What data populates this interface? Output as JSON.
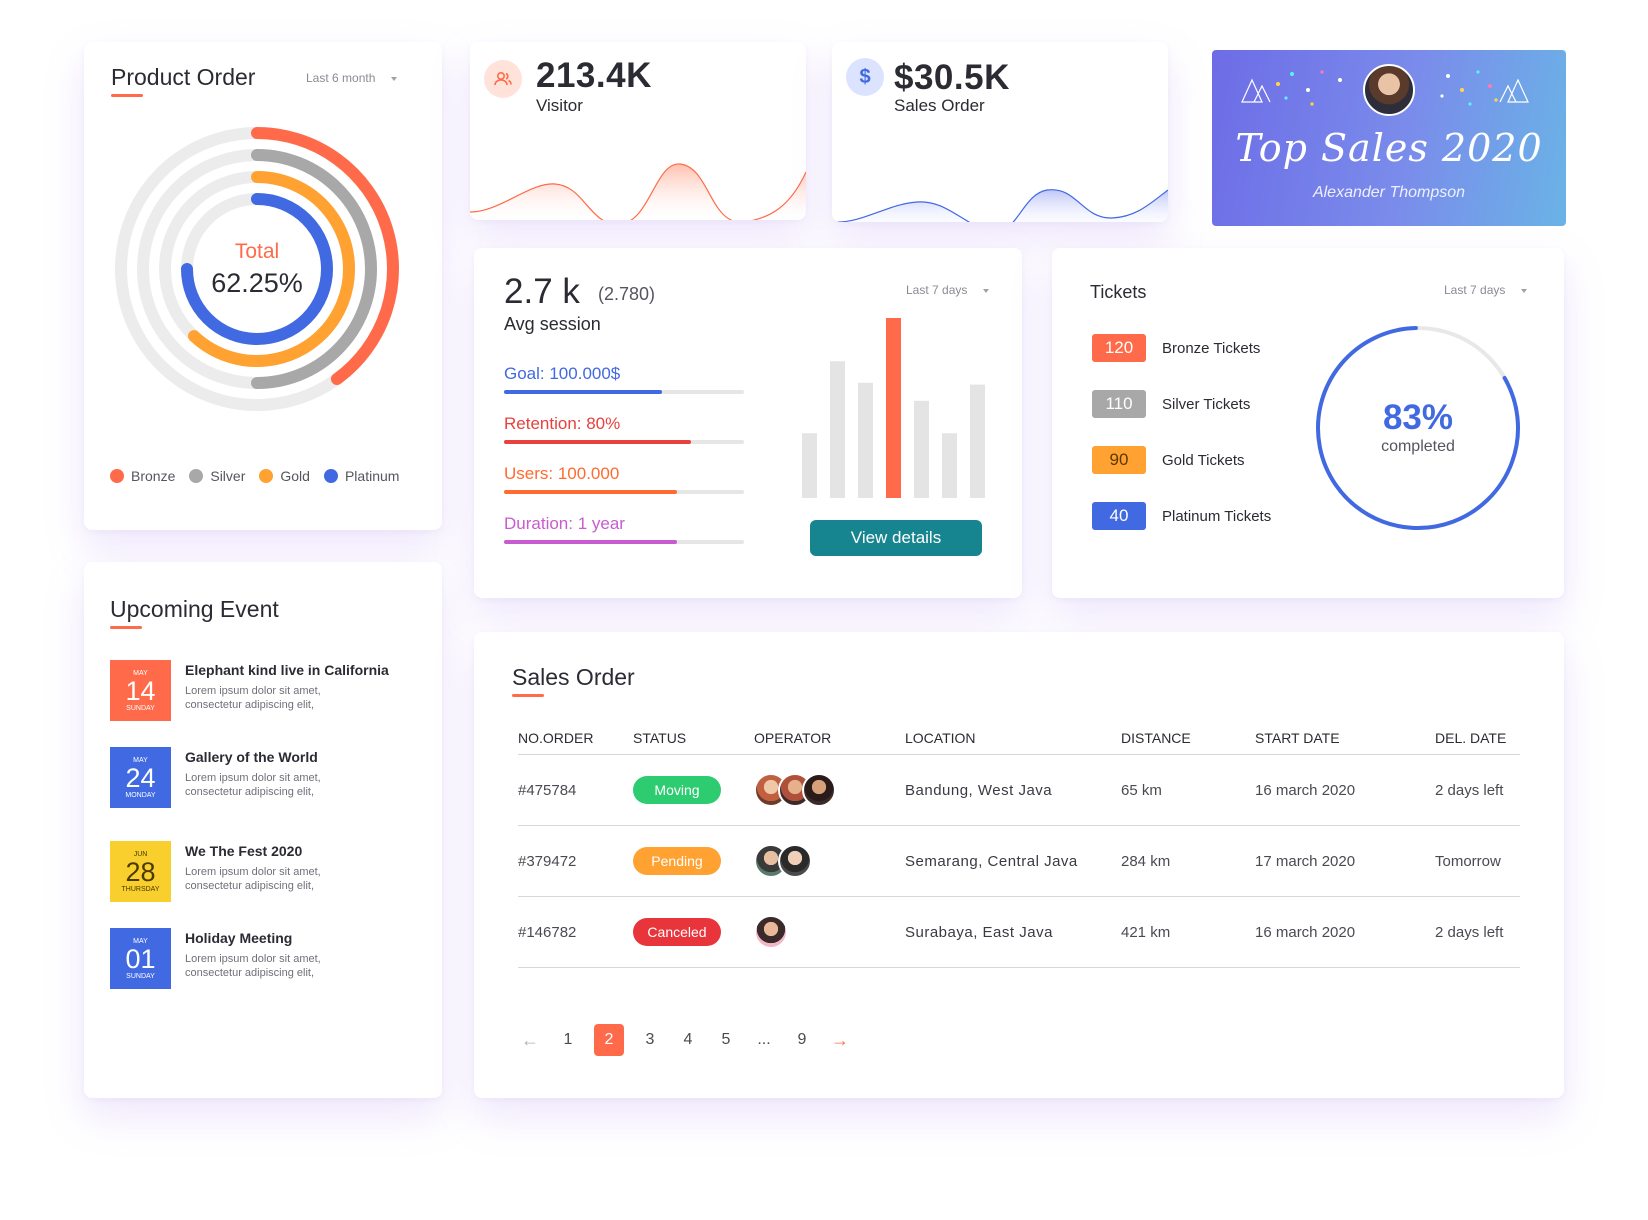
{
  "product_order": {
    "title": "Product Order",
    "period": "Last 6 month",
    "total_label": "Total",
    "total_value": "62.25%",
    "legend": [
      {
        "label": "Bronze",
        "color": "#ff6b4a"
      },
      {
        "label": "Silver",
        "color": "#a8a8a8"
      },
      {
        "label": "Gold",
        "color": "#ffa231"
      },
      {
        "label": "Platinum",
        "color": "#4169e1"
      }
    ],
    "rings": [
      {
        "name": "Bronze",
        "fraction": 0.4,
        "color": "#ff6b4a"
      },
      {
        "name": "Silver",
        "fraction": 0.5,
        "color": "#a8a8a8"
      },
      {
        "name": "Gold",
        "fraction": 0.62,
        "color": "#ffa231"
      },
      {
        "name": "Platinum",
        "fraction": 0.75,
        "color": "#4169e1"
      }
    ]
  },
  "visitor": {
    "value": "213.4K",
    "label": "Visitor",
    "icon": "users-icon",
    "color": "#ff6b4a"
  },
  "sales_order_metric": {
    "value": "$30.5K",
    "label": "Sales Order",
    "icon": "dollar-icon",
    "icon_glyph": "$",
    "color": "#4169e1"
  },
  "top_sales": {
    "title": "Top Sales 2020",
    "name": "Alexander Thompson"
  },
  "avg_session": {
    "value": "2.7 k",
    "raw": "(2.780)",
    "label": "Avg session",
    "period": "Last 7 days",
    "goals": [
      {
        "label": "Goal: 100.000$",
        "color": "#4169e1",
        "fraction": 0.66
      },
      {
        "label": "Retention: 80%",
        "color": "#e8413e",
        "fraction": 0.78
      },
      {
        "label": "Users: 100.000",
        "color": "#ff6b30",
        "fraction": 0.72
      },
      {
        "label": "Duration: 1 year",
        "color": "#c85bd0",
        "fraction": 0.72
      }
    ],
    "bars": [
      0.36,
      0.76,
      0.64,
      1.0,
      0.54,
      0.36,
      0.63
    ],
    "highlight_index": 3,
    "button": "View details"
  },
  "tickets": {
    "title": "Tickets",
    "period": "Last 7 days",
    "items": [
      {
        "count": "120",
        "label": "Bronze Tickets",
        "color": "#ff6b4a"
      },
      {
        "count": "110",
        "label": "Silver Tickets",
        "color": "#a8a8a8"
      },
      {
        "count": "90",
        "label": "Gold Tickets",
        "color": "#ffa231"
      },
      {
        "count": "40",
        "label": "Platinum Tickets",
        "color": "#4169e1"
      }
    ],
    "percent": "83%",
    "percent_label": "completed",
    "completion": 0.83
  },
  "events": {
    "title": "Upcoming Event",
    "items": [
      {
        "month": "MAY",
        "day": "14",
        "weekday": "SUNDAY",
        "color": "#ff6b4a",
        "title": "Elephant kind live in California",
        "desc": "Lorem ipsum dolor sit amet, consectetur adipiscing elit,"
      },
      {
        "month": "MAY",
        "day": "24",
        "weekday": "MONDAY",
        "color": "#4169e1",
        "title": "Gallery of the World",
        "desc": "Lorem ipsum dolor sit amet, consectetur adipiscing elit,"
      },
      {
        "month": "JUN",
        "day": "28",
        "weekday": "THURSDAY",
        "color": "#f8cf2c",
        "title": "We The Fest 2020",
        "desc": "Lorem ipsum dolor sit amet, consectetur adipiscing elit,"
      },
      {
        "month": "MAY",
        "day": "01",
        "weekday": "SUNDAY",
        "color": "#4169e1",
        "title": "Holiday Meeting",
        "desc": "Lorem ipsum dolor sit amet, consectetur adipiscing elit,"
      }
    ]
  },
  "sales_table": {
    "title": "Sales Order",
    "columns": [
      "NO.ORDER",
      "STATUS",
      "OPERATOR",
      "LOCATION",
      "DISTANCE",
      "START DATE",
      "DEL. DATE"
    ],
    "rows": [
      {
        "order": "#475784",
        "status": "Moving",
        "status_color": "#2ecc71",
        "operators": 3,
        "location": "Bandung, West Java",
        "distance": "65 km",
        "start": "16 march 2020",
        "delivery": "2 days left"
      },
      {
        "order": "#379472",
        "status": "Pending",
        "status_color": "#ffa231",
        "operators": 2,
        "location": "Semarang, Central Java",
        "distance": "284 km",
        "start": "17 march 2020",
        "delivery": "Tomorrow"
      },
      {
        "order": "#146782",
        "status": "Canceled",
        "status_color": "#e8353b",
        "operators": 1,
        "location": "Surabaya, East Java",
        "distance": "421 km",
        "start": "16 march 2020",
        "delivery": "2 days left"
      }
    ],
    "pagination": [
      "1",
      "2",
      "3",
      "4",
      "5",
      "...",
      "9"
    ],
    "active_page": "2"
  }
}
